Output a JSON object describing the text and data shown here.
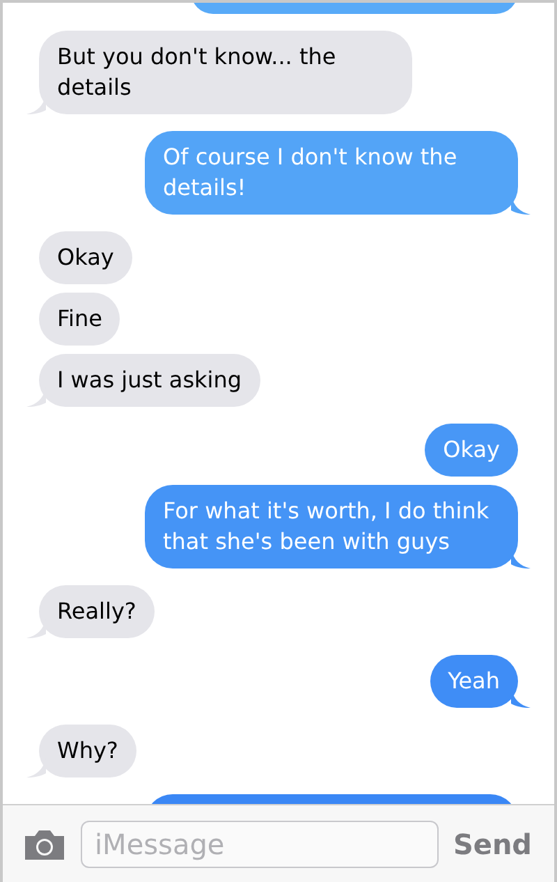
{
  "messages": [
    {
      "kind": "sent_partial",
      "tail": false
    },
    {
      "kind": "received",
      "text": "But you don't know... the details",
      "tail": true
    },
    {
      "kind": "sent",
      "text": "Of course I don't know the details!",
      "tail": true
    },
    {
      "kind": "received",
      "text": "Okay",
      "tail": false
    },
    {
      "kind": "received",
      "text": "Fine",
      "tail": false
    },
    {
      "kind": "received",
      "text": "I was just asking",
      "tail": true
    },
    {
      "kind": "sent",
      "text": "Okay",
      "tail": false
    },
    {
      "kind": "sent",
      "text": "For what it's worth, I do think that she's been with guys",
      "tail": true
    },
    {
      "kind": "received",
      "text": "Really?",
      "tail": true
    },
    {
      "kind": "sent",
      "text": "Yeah",
      "tail": true
    },
    {
      "kind": "received",
      "text": "Why?",
      "tail": true
    },
    {
      "kind": "sent_partial",
      "tail": false
    }
  ],
  "composer": {
    "placeholder": "iMessage",
    "send": "Send"
  }
}
